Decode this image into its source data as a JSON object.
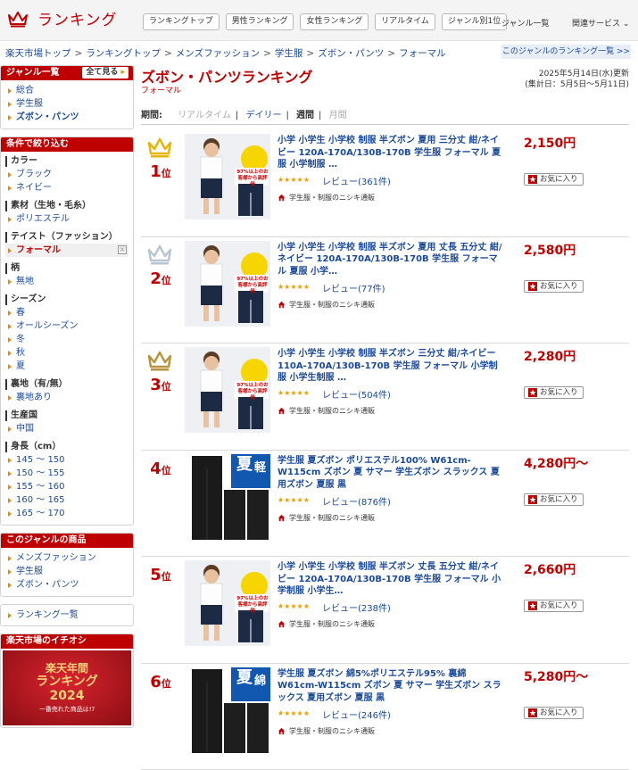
{
  "header": {
    "logo_text": "ランキング",
    "nav": [
      "ランキングトップ",
      "男性ランキング",
      "女性ランキング",
      "リアルタイム",
      "ジャンル別1位"
    ],
    "genre_menu": "ジャンル一覧",
    "related": "関連サービス ⌄"
  },
  "breadcrumb": [
    "楽天市場トップ",
    "ランキングトップ",
    "メンズファッション",
    "学生服",
    "ズボン・パンツ",
    "フォーマル"
  ],
  "genre_list_link": "このジャンルのランキング一覧 >>",
  "sidebar": {
    "genre_box": {
      "title": "ジャンル一覧",
      "all_button": "全て見る",
      "items": [
        "総合",
        "学生服",
        "ズボン・パンツ"
      ]
    },
    "filter_box": {
      "title": "条件で絞り込む",
      "sections": [
        {
          "name": "カラー",
          "items": [
            "ブラック",
            "ネイビー"
          ]
        },
        {
          "name": "素材（生地・毛糸）",
          "items": [
            "ポリエステル"
          ]
        },
        {
          "name": "テイスト（ファッション）",
          "items": [
            "フォーマル"
          ],
          "selected": true
        },
        {
          "name": "柄",
          "items": [
            "無地"
          ]
        },
        {
          "name": "シーズン",
          "items": [
            "春",
            "オールシーズン",
            "冬",
            "秋",
            "夏"
          ]
        },
        {
          "name": "裏地（有/無）",
          "items": [
            "裏地あり"
          ]
        },
        {
          "name": "生産国",
          "items": [
            "中国"
          ]
        },
        {
          "name": "身長（cm）",
          "items": [
            "145 〜 150",
            "150 〜 155",
            "155 〜 160",
            "160 〜 165",
            "165 〜 170"
          ]
        }
      ]
    },
    "genre_products_box": {
      "title": "このジャンルの商品",
      "items": [
        "メンズファッション",
        "学生服",
        "ズボン・パンツ"
      ]
    },
    "ranking_list_link": "ランキング一覧",
    "pick_box": {
      "title": "楽天市場のイチオシ",
      "banner_lines": [
        "楽天年間",
        "ランキング",
        "2024",
        "ー番売れた商品は!?"
      ]
    }
  },
  "main": {
    "title": "ズボン・パンツランキング",
    "subtitle": "フォーマル",
    "updated_line1": "2025年5月14日(水)更新",
    "updated_line2": "(集計日：5月5日〜5月11日)",
    "period_label": "期間:",
    "period_options": [
      "リアルタイム",
      "デイリー",
      "週間",
      "月間"
    ],
    "period_active": "週間"
  },
  "items": [
    {
      "rank": "1",
      "suffix": "位",
      "crown": "gold",
      "title": "小学 小学生 小学校 制服 半ズボン 夏用 三分丈 紺/ネイビー 120A-170A/130B-170B 学生服 フォーマル 夏服 小学制服 …",
      "stars": "★★★★★",
      "review": "レビュー(361件)",
      "shop": "学生服・制服のニシキ通販",
      "price": "2,150円",
      "fav": "お気に入り",
      "thumb": "short"
    },
    {
      "rank": "2",
      "suffix": "位",
      "crown": "silver",
      "title": "小学 小学生 小学校 制服 半ズボン 夏用 丈長 五分丈 紺/ネイビー 120A-170A/130B-170B 学生服 フォーマル 夏服 小学…",
      "stars": "★★★★★",
      "review": "レビュー(77件)",
      "shop": "学生服・制服のニシキ通販",
      "price": "2,580円",
      "fav": "お気に入り",
      "thumb": "short"
    },
    {
      "rank": "3",
      "suffix": "位",
      "crown": "bronze",
      "title": "小学 小学生 小学校 制服 半ズボン 三分丈 紺/ネイビー 110A-170A/130B-170B 学生服 フォーマル 小学制服 小学生制服 …",
      "stars": "★★★★★",
      "review": "レビュー(504件)",
      "shop": "学生服・制服のニシキ通販",
      "price": "2,280円",
      "fav": "お気に入り",
      "thumb": "short"
    },
    {
      "rank": "4",
      "suffix": "位",
      "crown": "",
      "title": "学生服 夏ズボン ポリエステル100% W61cm-W115cm ズボン 夏 サマー 学生ズボン スラックス 夏用ズボン 夏服 黒",
      "stars": "★★★★★",
      "review": "レビュー(876件)",
      "shop": "学生服・制服のニシキ通販",
      "price": "4,280円〜",
      "fav": "お気に入り",
      "thumb": "long",
      "badge": "夏"
    },
    {
      "rank": "5",
      "suffix": "位",
      "crown": "",
      "title": "小学 小学生 小学校 制服 半ズボン 丈長 五分丈 紺/ネイビー 120A-170A/130B-170B 学生服 フォーマル 小学制服 小学生…",
      "stars": "★★★★★",
      "review": "レビュー(238件)",
      "shop": "学生服・制服のニシキ通販",
      "price": "2,660円",
      "fav": "お気に入り",
      "thumb": "short"
    },
    {
      "rank": "6",
      "suffix": "位",
      "crown": "",
      "title": "学生服 夏ズボン 綿5%ポリエステル95% 裏綿 W61cm-W115cm ズボン 夏 サマー 学生ズボン スラックス 夏用ズボン 夏服 黒",
      "stars": "★★★★★",
      "review": "レビュー(246件)",
      "shop": "学生服・制服のニシキ通販",
      "price": "5,280円〜",
      "fav": "お気に入り",
      "thumb": "long",
      "badge": "夏"
    }
  ],
  "thumb_text": {
    "short_badge": "97%以上のお客様から高評価",
    "long_side": "軽",
    "long_side2": "綿"
  },
  "colors": {
    "accent": "#bf0000",
    "link": "#1a4a9c",
    "gold": "#e8b400",
    "silver": "#b8c4d0",
    "bronze": "#b8923c"
  }
}
